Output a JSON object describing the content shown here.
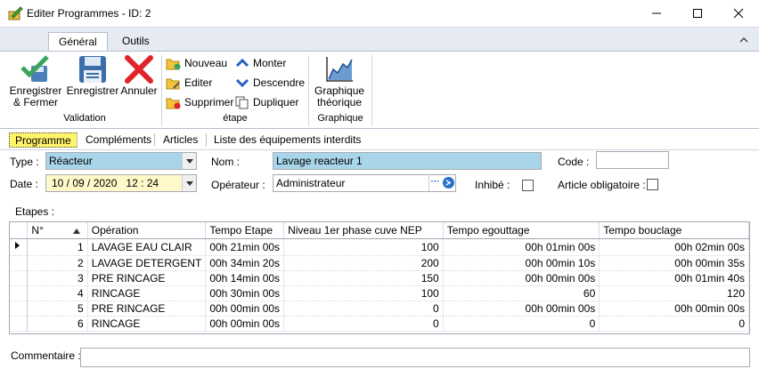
{
  "window": {
    "title": "Editer Programmes - ID: 2"
  },
  "ribbon": {
    "tabs": [
      {
        "label": "Général",
        "active": true
      },
      {
        "label": "Outils",
        "active": false
      }
    ],
    "groups": {
      "validation": {
        "label": "Validation",
        "buttons": [
          {
            "label": "Enregistrer & Fermer",
            "icon": "save-close-icon"
          },
          {
            "label": "Enregistrer",
            "icon": "floppy-disk-icon"
          },
          {
            "label": "Annuler",
            "icon": "red-x-icon"
          }
        ]
      },
      "etape": {
        "label": "étape",
        "buttons": [
          {
            "label": "Nouveau",
            "icon": "folder-add-icon"
          },
          {
            "label": "Editer",
            "icon": "folder-edit-icon"
          },
          {
            "label": "Supprimer",
            "icon": "folder-delete-icon"
          },
          {
            "label": "Monter",
            "icon": "chevron-up-icon"
          },
          {
            "label": "Descendre",
            "icon": "chevron-down-icon"
          },
          {
            "label": "Dupliquer",
            "icon": "duplicate-icon"
          }
        ]
      },
      "graphique": {
        "label": "Graphique",
        "buttons": [
          {
            "label": "Graphique théorique",
            "icon": "chart-icon"
          }
        ]
      }
    }
  },
  "doc_tabs": [
    "Programme",
    "Compléments",
    "Articles",
    "Liste des équipements interdits"
  ],
  "form": {
    "type_label": "Type :",
    "type_value": "Réacteur",
    "nom_label": "Nom :",
    "nom_value": "Lavage reacteur 1",
    "code_label": "Code :",
    "code_value": "",
    "date_label": "Date :",
    "date_value": "10 / 09 / 2020   12 : 24",
    "operateur_label": "Opérateur :",
    "operateur_value": "Administrateur",
    "inhibe_label": "Inhibé :",
    "inhibe_checked": false,
    "article_label": "Article obligatoire :",
    "article_checked": false,
    "etapes_label": "Etapes :",
    "commentaire_label": "Commentaire :",
    "commentaire_value": ""
  },
  "grid": {
    "columns": [
      "N°",
      "Opération",
      "Tempo Etape",
      "Niveau 1er phase cuve NEP",
      "Tempo egouttage",
      "Tempo bouclage"
    ],
    "rows": [
      [
        "1",
        "LAVAGE EAU CLAIR",
        "00h 21min 00s",
        "100",
        "00h 01min 00s",
        "00h 02min 00s"
      ],
      [
        "2",
        "LAVAGE DETERGENT",
        "00h 34min 20s",
        "200",
        "00h 00min 10s",
        "00h 00min 35s"
      ],
      [
        "3",
        "PRE RINCAGE",
        "00h 14min 00s",
        "150",
        "00h 00min 00s",
        "00h 01min 40s"
      ],
      [
        "4",
        "RINCAGE",
        "00h 30min 00s",
        "100",
        "60",
        "120"
      ],
      [
        "5",
        "PRE RINCAGE",
        "00h 00min 00s",
        "0",
        "00h 00min 00s",
        "00h 00min 00s"
      ],
      [
        "6",
        "RINCAGE",
        "00h 00min 00s",
        "0",
        "0",
        "0"
      ]
    ]
  }
}
